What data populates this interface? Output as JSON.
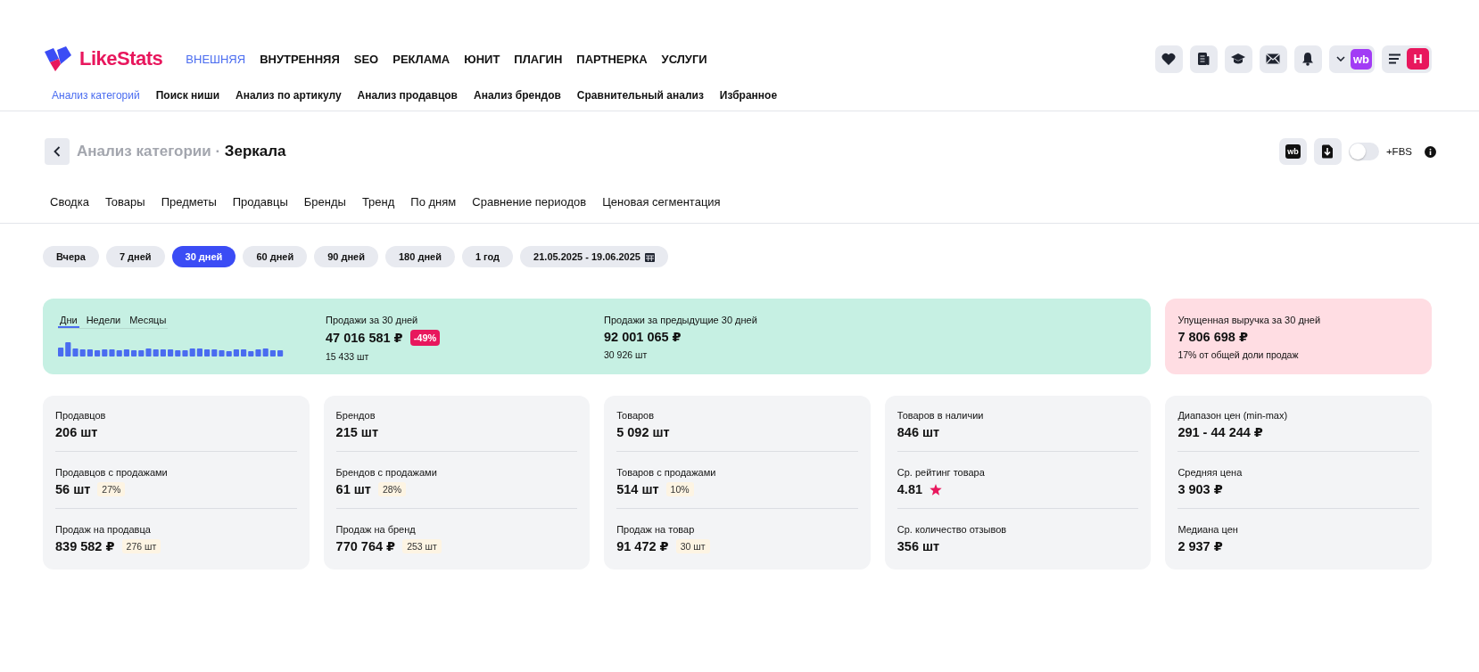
{
  "header": {
    "logo": "LikeStats",
    "nav": [
      {
        "label": "ВНЕШНЯЯ",
        "selected": true
      },
      {
        "label": "ВНУТРЕННЯЯ",
        "selected": false
      },
      {
        "label": "SEO",
        "selected": false
      },
      {
        "label": "РЕКЛАМА",
        "selected": false
      },
      {
        "label": "ЮНИТ",
        "selected": false
      },
      {
        "label": "ПЛАГИН",
        "selected": false
      },
      {
        "label": "ПАРТНЕРКА",
        "selected": false
      },
      {
        "label": "УСЛУГИ",
        "selected": false
      }
    ],
    "marketplace_badge": "wb",
    "user_initial": "Н",
    "subnav": [
      {
        "label": "Анализ категорий",
        "selected": true
      },
      {
        "label": "Поиск ниши",
        "selected": false
      },
      {
        "label": "Анализ по артикулу",
        "selected": false
      },
      {
        "label": "Анализ продавцов",
        "selected": false
      },
      {
        "label": "Анализ брендов",
        "selected": false
      },
      {
        "label": "Сравнительный анализ",
        "selected": false
      },
      {
        "label": "Избранное",
        "selected": false
      }
    ]
  },
  "page": {
    "breadcrumb": "Анализ категории ·",
    "title": "Зеркала",
    "marketplace_label": "wb",
    "fbs_toggle": {
      "label": "+FBS",
      "on": false
    }
  },
  "tabs": [
    "Сводка",
    "Товары",
    "Предметы",
    "Продавцы",
    "Бренды",
    "Тренд",
    "По дням",
    "Сравнение периодов",
    "Ценовая сегментация"
  ],
  "periods": [
    {
      "label": "Вчера",
      "kind": "preset",
      "selected": false
    },
    {
      "label": "7 дней",
      "kind": "preset",
      "selected": false
    },
    {
      "label": "30 дней",
      "kind": "preset",
      "selected": true
    },
    {
      "label": "60 дней",
      "kind": "preset",
      "selected": false
    },
    {
      "label": "90 дней",
      "kind": "preset",
      "selected": false
    },
    {
      "label": "180 дней",
      "kind": "preset",
      "selected": false
    },
    {
      "label": "1 год",
      "kind": "preset",
      "selected": false
    },
    {
      "label": "21.05.2025 - 19.06.2025",
      "kind": "date_range",
      "selected": false
    }
  ],
  "summary": {
    "view_tabs": [
      {
        "label": "Дни",
        "selected": true
      },
      {
        "label": "Недели",
        "selected": false
      },
      {
        "label": "Месяцы",
        "selected": false
      }
    ],
    "sales": {
      "label": "Продажи за 30 дней",
      "value": "47 016 581 ₽",
      "change": "-49%",
      "units": "15 433 шт"
    },
    "previous": {
      "label": "Продажи за предыдущие 30 дней",
      "value": "92 001 065 ₽",
      "units": "30 926 шт"
    },
    "lost": {
      "label": "Упущенная выручка за 30 дней",
      "value": "7 806 698 ₽",
      "note": "17% от общей доли продаж"
    }
  },
  "cards": [
    {
      "metrics": [
        {
          "label": "Продавцов",
          "value": "206 шт",
          "kind": "plain"
        },
        {
          "label": "Продавцов с продажами",
          "value": "56 шт",
          "badge": "27%",
          "kind": "plain"
        },
        {
          "label": "Продаж на продавца",
          "value": "839 582 ₽",
          "badge": "276 шт",
          "kind": "plain"
        }
      ]
    },
    {
      "metrics": [
        {
          "label": "Брендов",
          "value": "215 шт",
          "kind": "plain"
        },
        {
          "label": "Брендов с продажами",
          "value": "61 шт",
          "badge": "28%",
          "kind": "plain"
        },
        {
          "label": "Продаж на бренд",
          "value": "770 764 ₽",
          "badge": "253 шт",
          "kind": "plain"
        }
      ]
    },
    {
      "metrics": [
        {
          "label": "Товаров",
          "value": "5 092 шт",
          "kind": "plain"
        },
        {
          "label": "Товаров с продажами",
          "value": "514 шт",
          "badge": "10%",
          "kind": "plain"
        },
        {
          "label": "Продаж на товар",
          "value": "91 472 ₽",
          "badge": "30 шт",
          "kind": "plain"
        }
      ]
    },
    {
      "metrics": [
        {
          "label": "Товаров в наличии",
          "value": "846 шт",
          "kind": "plain"
        },
        {
          "label": "Ср. рейтинг товара",
          "value": "4.81",
          "kind": "rating"
        },
        {
          "label": "Ср. количество отзывов",
          "value": "356 шт",
          "kind": "plain"
        }
      ]
    },
    {
      "metrics": [
        {
          "label": "Диапазон цен (min-max)",
          "value": "291 - 44 244 ₽",
          "kind": "plain"
        },
        {
          "label": "Средняя цена",
          "value": "3 903 ₽",
          "kind": "plain"
        },
        {
          "label": "Медиана цен",
          "value": "2 937 ₽",
          "kind": "plain"
        }
      ]
    }
  ]
}
